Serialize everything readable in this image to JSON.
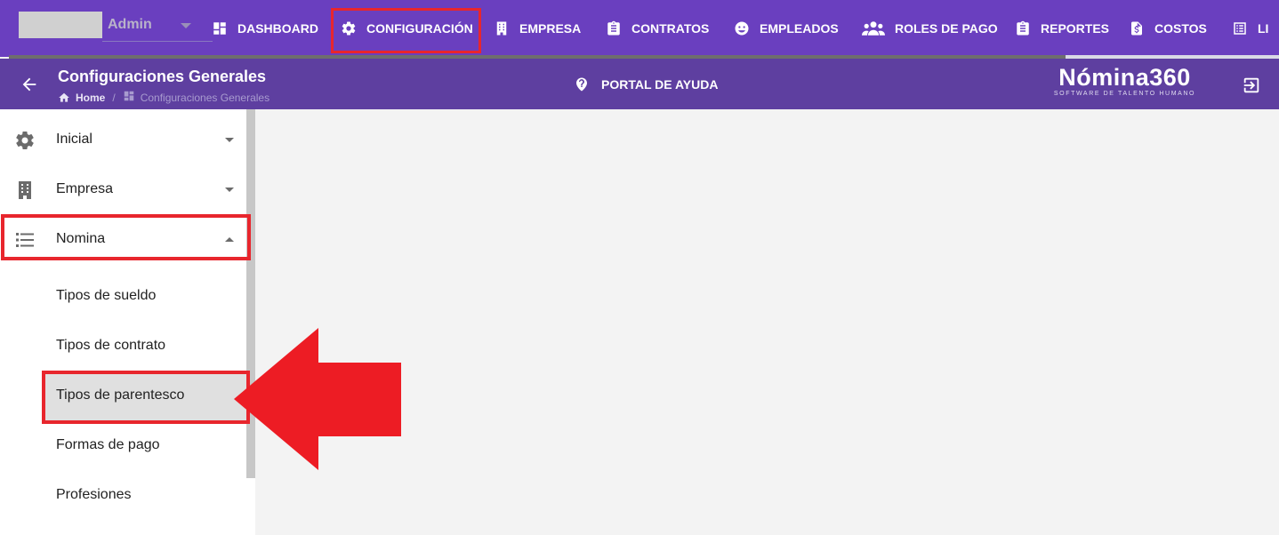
{
  "header": {
    "user_name": "Admin",
    "nav": [
      {
        "label": "DASHBOARD",
        "icon": "dashboard-icon"
      },
      {
        "label": "CONFIGURACIÓN",
        "icon": "gear-icon"
      },
      {
        "label": "EMPRESA",
        "icon": "building-icon"
      },
      {
        "label": "CONTRATOS",
        "icon": "clipboard-icon"
      },
      {
        "label": "EMPLEADOS",
        "icon": "face-icon"
      },
      {
        "label": "ROLES DE PAGO",
        "icon": "people-icon"
      },
      {
        "label": "REPORTES",
        "icon": "clipboard-icon"
      },
      {
        "label": "COSTOS",
        "icon": "dollar-file-icon"
      },
      {
        "label": "LI",
        "icon": "list-icon"
      }
    ]
  },
  "subheader": {
    "title": "Configuraciones Generales",
    "breadcrumb_home": "Home",
    "breadcrumb_sep": "/",
    "breadcrumb_current": "Configuraciones Generales",
    "help_label": "PORTAL DE AYUDA",
    "brand_name": "Nómina360",
    "brand_tagline": "SOFTWARE DE TALENTO HUMANO"
  },
  "sidebar": {
    "items": [
      {
        "label": "Inicial",
        "icon": "gear-icon"
      },
      {
        "label": "Empresa",
        "icon": "building-icon"
      },
      {
        "label": "Nomina",
        "icon": "list-icon"
      }
    ],
    "sub_items": [
      {
        "label": "Tipos de sueldo"
      },
      {
        "label": "Tipos de contrato"
      },
      {
        "label": "Tipos de parentesco"
      },
      {
        "label": "Formas de pago"
      },
      {
        "label": "Profesiones"
      }
    ]
  },
  "colors": {
    "topbar": "#6a3fbf",
    "subbar": "#5e3fa0",
    "highlight_red": "#e8262d",
    "arrow_red": "#ed1c24"
  }
}
